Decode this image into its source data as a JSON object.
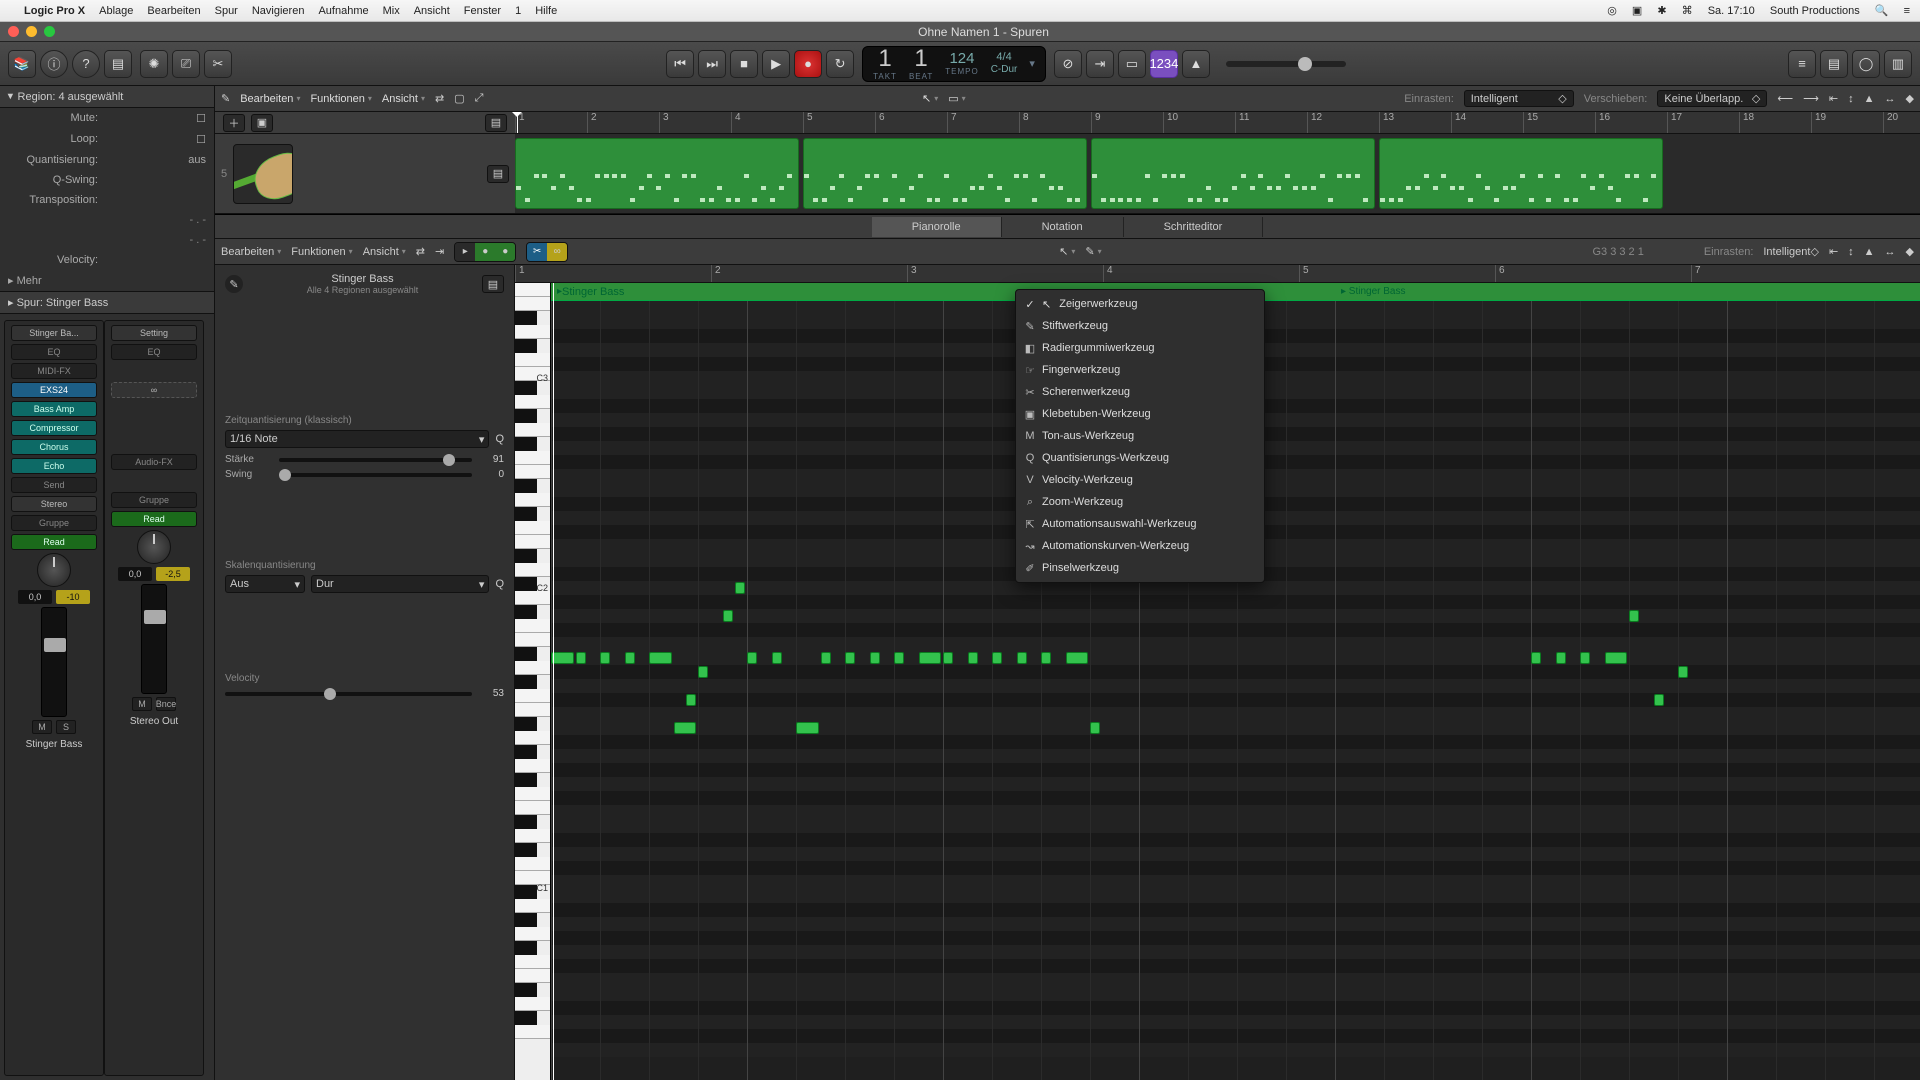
{
  "menubar": {
    "app": "Logic Pro X",
    "items": [
      "Ablage",
      "Bearbeiten",
      "Spur",
      "Navigieren",
      "Aufnahme",
      "Mix",
      "Ansicht",
      "Fenster",
      "1",
      "Hilfe"
    ],
    "clock": "Sa. 17:10",
    "user": "South Productions"
  },
  "window": {
    "title": "Ohne Namen 1 - Spuren"
  },
  "lcd": {
    "bar": "1",
    "beat": "1",
    "tempo": "124",
    "sig": "4/4",
    "key": "C-Dur",
    "lbl_bar": "TAKT",
    "lbl_beat": "BEAT",
    "lbl_tempo": "TEMPO"
  },
  "purpleBtn": "1234",
  "inspector": {
    "header": "Region: 4 ausgewählt",
    "rows": {
      "mute": "Mute:",
      "loop": "Loop:",
      "quant": "Quantisierung:",
      "quant_v": "aus",
      "qswing": "Q-Swing:",
      "transp": "Transposition:",
      "dash1": "- . -",
      "dash2": "- . -",
      "velocity": "Velocity:",
      "more": "Mehr"
    },
    "trackHeader": "Spur: Stinger Bass"
  },
  "strip1": {
    "name": "Stinger Ba...",
    "setting": "Setting",
    "eq": "EQ",
    "midifx": "MIDI-FX",
    "inst": "EXS24",
    "fx": [
      "Bass Amp",
      "Compressor",
      "Chorus",
      "Echo"
    ],
    "send": "Send",
    "out": "Stereo",
    "group": "Gruppe",
    "auto": "Read",
    "pan": "0,0",
    "gain": "-10",
    "ms_m": "M",
    "ms_s": "S",
    "label": "Stinger Bass"
  },
  "strip2": {
    "name": "Setting",
    "eq": "EQ",
    "audiofx": "Audio-FX",
    "group": "Gruppe",
    "auto": "Read",
    "pan": "0,0",
    "gain": "-2,5",
    "ms_m": "M",
    "bnce": "Bnce",
    "label": "Stereo Out"
  },
  "tracksToolbar": {
    "edit": "Bearbeiten",
    "func": "Funktionen",
    "view": "Ansicht",
    "snapLbl": "Einrasten:",
    "snapVal": "Intelligent",
    "moveLbl": "Verschieben:",
    "moveVal": "Keine Überlapp."
  },
  "bars1": [
    "1",
    "2",
    "3",
    "4",
    "5",
    "6",
    "7",
    "8",
    "9",
    "10",
    "11",
    "12",
    "13",
    "14",
    "15",
    "16",
    "17",
    "18",
    "19",
    "20"
  ],
  "trackHead": {
    "num": "5"
  },
  "edTabs": {
    "piano": "Pianorolle",
    "notation": "Notation",
    "step": "Schritteditor"
  },
  "edToolbar": {
    "edit": "Bearbeiten",
    "func": "Funktionen",
    "view": "Ansicht",
    "info": "G3  3 3 2 1",
    "snapLbl": "Einrasten:",
    "snapVal": "Intelligent"
  },
  "edLeft": {
    "title": "Stinger Bass",
    "subtitle": "Alle 4 Regionen ausgewählt",
    "tq": "Zeitquantisierung (klassisch)",
    "tq_val": "1/16 Note",
    "strength": "Stärke",
    "strength_v": "91",
    "swing": "Swing",
    "swing_v": "0",
    "sq": "Skalenquantisierung",
    "sq_a": "Aus",
    "sq_b": "Dur",
    "vel": "Velocity",
    "vel_v": "53"
  },
  "pianoBars": [
    "1",
    "2",
    "3",
    "4",
    "5",
    "6",
    "7"
  ],
  "octaves": [
    "C3",
    "C2",
    "C1"
  ],
  "regionStrip": "Stinger Bass",
  "regionStrip2": "Stinger Bass",
  "toolsMenu": [
    {
      "icon": "↖",
      "label": "Zeigerwerkzeug",
      "checked": true
    },
    {
      "icon": "✎",
      "label": "Stiftwerkzeug"
    },
    {
      "icon": "◧",
      "label": "Radiergummiwerkzeug"
    },
    {
      "icon": "☞",
      "label": "Fingerwerkzeug"
    },
    {
      "icon": "✂",
      "label": "Scherenwerkzeug"
    },
    {
      "icon": "▣",
      "label": "Klebetuben-Werkzeug"
    },
    {
      "icon": "M",
      "label": "Ton-aus-Werkzeug"
    },
    {
      "icon": "Q",
      "label": "Quantisierungs-Werkzeug"
    },
    {
      "icon": "V",
      "label": "Velocity-Werkzeug"
    },
    {
      "icon": "⌕",
      "label": "Zoom-Werkzeug"
    },
    {
      "icon": "⇱",
      "label": "Automationsauswahl-Werkzeug"
    },
    {
      "icon": "↝",
      "label": "Automationskurven-Werkzeug"
    },
    {
      "icon": "✐",
      "label": "Pinselwerkzeug"
    }
  ],
  "chart_data": null
}
